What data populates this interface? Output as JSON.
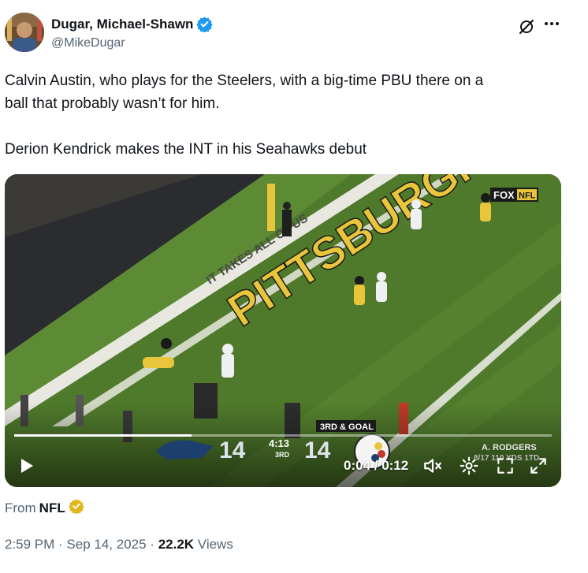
{
  "author": {
    "display_name": "Dugar, Michael-Shawn",
    "handle": "@MikeDugar"
  },
  "tweet": {
    "line1": "Calvin Austin, who plays for the Steelers, with a big-time PBU there on a",
    "line2": "ball that probably wasn’t for him.",
    "line3": "Derion Kendrick makes the INT in his Seahawks debut"
  },
  "video": {
    "network": "FOX",
    "network_sub": "NFL",
    "end_zone_text": "PITTSBURGH",
    "sideline_text": "IT TAKES ALL OF US",
    "time_display": "0:04 / 0:12",
    "progress_fraction": 0.33,
    "scorebug": {
      "away_score": "14",
      "home_score": "14",
      "clock": "4:13",
      "quarter": "3RD",
      "down": "3RD & GOAL",
      "player_stat_name": "A. RODGERS",
      "player_stat_line": "8/17 110 YDS 1TD"
    }
  },
  "attribution": {
    "from_label": "From",
    "from_name": "NFL"
  },
  "meta": {
    "time": "2:59 PM",
    "sep1": " · ",
    "date": "Sep 14, 2025",
    "sep2": " · ",
    "views_count": "22.2K",
    "views_label": " Views"
  },
  "colors": {
    "verified_blue": "#1d9bf0",
    "verified_gold": "#e2b719",
    "field_green": "#4f7a2b",
    "endzone_text": "#e8c53a"
  }
}
